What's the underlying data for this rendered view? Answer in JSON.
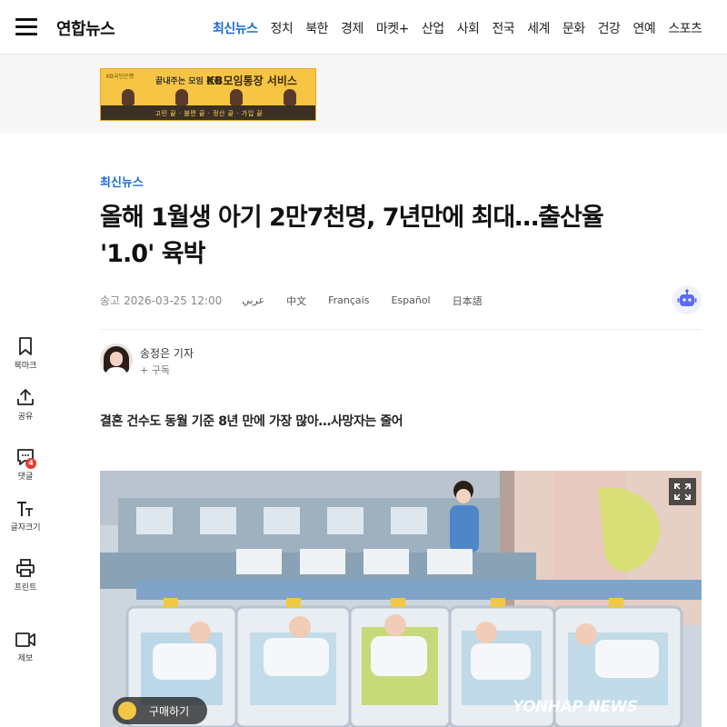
{
  "header": {
    "logo": "연합뉴스",
    "nav": [
      "최신뉴스",
      "정치",
      "북한",
      "경제",
      "마켓+",
      "산업",
      "사회",
      "전국",
      "세계",
      "문화",
      "건강",
      "연예",
      "스포츠"
    ]
  },
  "ad": {
    "brand": "KB국민은행",
    "top_text": "끝내주는 모임 관리",
    "title": "KB모임통장 서비스",
    "strip_text": "고민 끝 · 불편 끝 · 정산 끝 · 가입 끝"
  },
  "sidebar": {
    "items": [
      {
        "label": "북마크",
        "icon": "bookmark-icon"
      },
      {
        "label": "공유",
        "icon": "share-icon"
      },
      {
        "label": "댓글",
        "icon": "comment-icon",
        "badge": "4"
      },
      {
        "label": "글자크기",
        "icon": "font-size-icon"
      },
      {
        "label": "프린트",
        "icon": "print-icon"
      },
      {
        "label": "제보",
        "icon": "video-report-icon"
      }
    ]
  },
  "article": {
    "category": "최신뉴스",
    "headline_line1": "올해 1월생 아기 2만7천명, 7년만에 최대…출산율",
    "headline_line2": "'1.0' 육박",
    "published_label": "송고",
    "published_date": "2026-03-25 12:00",
    "languages": [
      "عربي",
      "中文",
      "Français",
      "Español",
      "日本語"
    ],
    "reporter_name": "송정은 기자",
    "subscribe_label": "+ 구독",
    "subtitle": "결혼 건수도 동월 기준 8년 만에 가장 많아…사망자는 줄어",
    "buy_label": "구매하기",
    "watermark": "YONHAP NEWS"
  },
  "colors": {
    "accent": "#1d6bd6",
    "ad_yellow": "#f6c544",
    "badge_red": "#e8392c"
  }
}
